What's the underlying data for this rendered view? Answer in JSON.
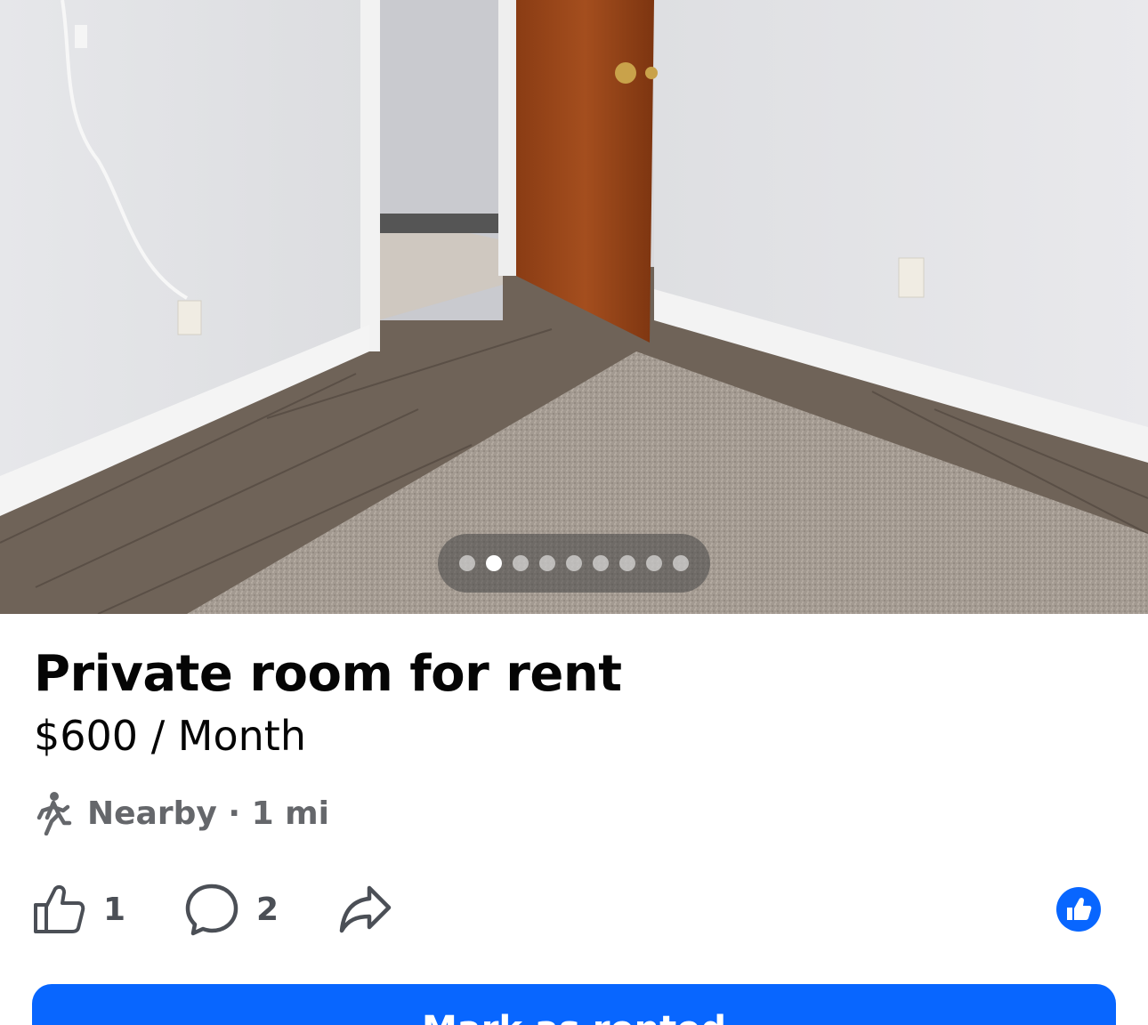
{
  "listing": {
    "title": "Private room for rent",
    "price": "$600 / Month",
    "location_text": "Nearby · 1 mi"
  },
  "carousel": {
    "total_images": 9,
    "active_index": 1
  },
  "actions": {
    "like_count": "1",
    "comment_count": "2"
  },
  "icons": {
    "location": "walking-person-icon",
    "like": "thumbs-up-icon",
    "comment": "comment-bubble-icon",
    "share": "share-arrow-icon",
    "reaction": "like-reaction-icon"
  },
  "primary_button": {
    "label": "Mark as rented"
  },
  "colors": {
    "accent": "#0866ff",
    "secondary_text": "#65676b"
  }
}
